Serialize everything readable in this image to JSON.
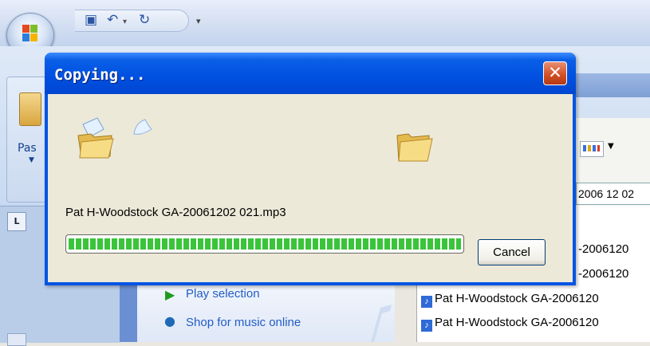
{
  "dialog": {
    "title": "Copying...",
    "close_symbol": "✕",
    "file_name": "Pat H-Woodstock GA-20061202 021.mp3",
    "progress": 1.0,
    "cancel_label": "Cancel",
    "source_folder_icon": "folder-open-icon",
    "dest_folder_icon": "folder-icon",
    "flying_paper_icon": "paper-icon"
  },
  "ribbon": {
    "paste_label": "Pas",
    "date_text": "2006 12 02"
  },
  "tasks": [
    {
      "label": "Play selection",
      "icon": "play-icon"
    },
    {
      "label": "Shop for music online",
      "icon": "globe-icon"
    }
  ],
  "files": [
    "-2006120",
    "-2006120",
    "Pat H-Woodstock GA-2006120",
    "Pat H-Woodstock GA-2006120"
  ],
  "colors": {
    "titlebar": "#0054e3",
    "progress": "#3ac43a",
    "close": "#d14d22"
  }
}
